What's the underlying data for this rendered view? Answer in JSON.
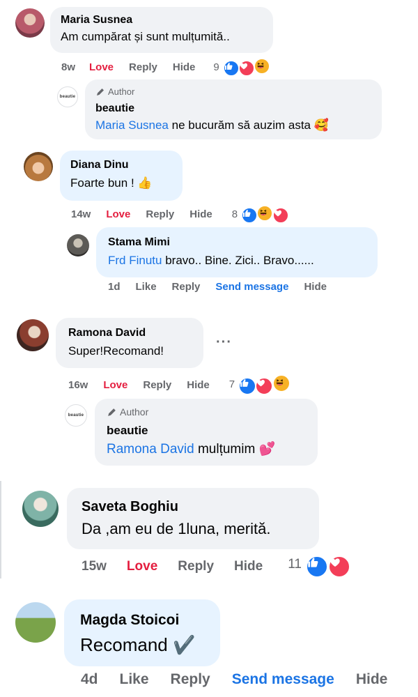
{
  "reactions_palette": {
    "like": "#1877f2",
    "love": "#f33e58",
    "haha": "#f7b125"
  },
  "comments": [
    {
      "name": "Maria Susnea",
      "text": "Am cumpărat și sunt mulțumită..",
      "time": "8w",
      "love": "Love",
      "reply": "Reply",
      "hide": "Hide",
      "count": "9",
      "reactions": [
        "like",
        "love",
        "haha"
      ]
    },
    {
      "author_label": "Author",
      "name": "beautie",
      "mention": "Maria Susnea",
      "text": " ne bucurăm să auzim asta 🥰",
      "logo_text": "beautie"
    },
    {
      "name": "Diana Dinu",
      "text": "Foarte bun ! 👍",
      "time": "14w",
      "love": "Love",
      "reply": "Reply",
      "hide": "Hide",
      "count": "8",
      "reactions": [
        "like",
        "haha",
        "love"
      ]
    },
    {
      "name": "Stama Mimi",
      "mention": "Frd Finutu",
      "text": " bravo.. Bine. Zici.. Bravo......",
      "time": "1d",
      "like": "Like",
      "reply": "Reply",
      "send": "Send message",
      "hide": "Hide"
    },
    {
      "name": "Ramona David",
      "text": "Super!Recomand!",
      "more": "···",
      "time": "16w",
      "love": "Love",
      "reply": "Reply",
      "hide": "Hide",
      "count": "7",
      "reactions": [
        "like",
        "love",
        "haha"
      ]
    },
    {
      "author_label": "Author",
      "name": "beautie",
      "mention": "Ramona David",
      "text": " mulțumim 💕",
      "logo_text": "beautie"
    },
    {
      "name": "Saveta Boghiu",
      "text": "Da ,am eu de 1luna, merită.",
      "time": "15w",
      "love": "Love",
      "reply": "Reply",
      "hide": "Hide",
      "count": "11",
      "reactions": [
        "like",
        "love"
      ]
    },
    {
      "name": "Magda Stoicoi",
      "text": "Recomand ✔️",
      "time": "4d",
      "like": "Like",
      "reply": "Reply",
      "send": "Send message",
      "hide": "Hide"
    }
  ]
}
